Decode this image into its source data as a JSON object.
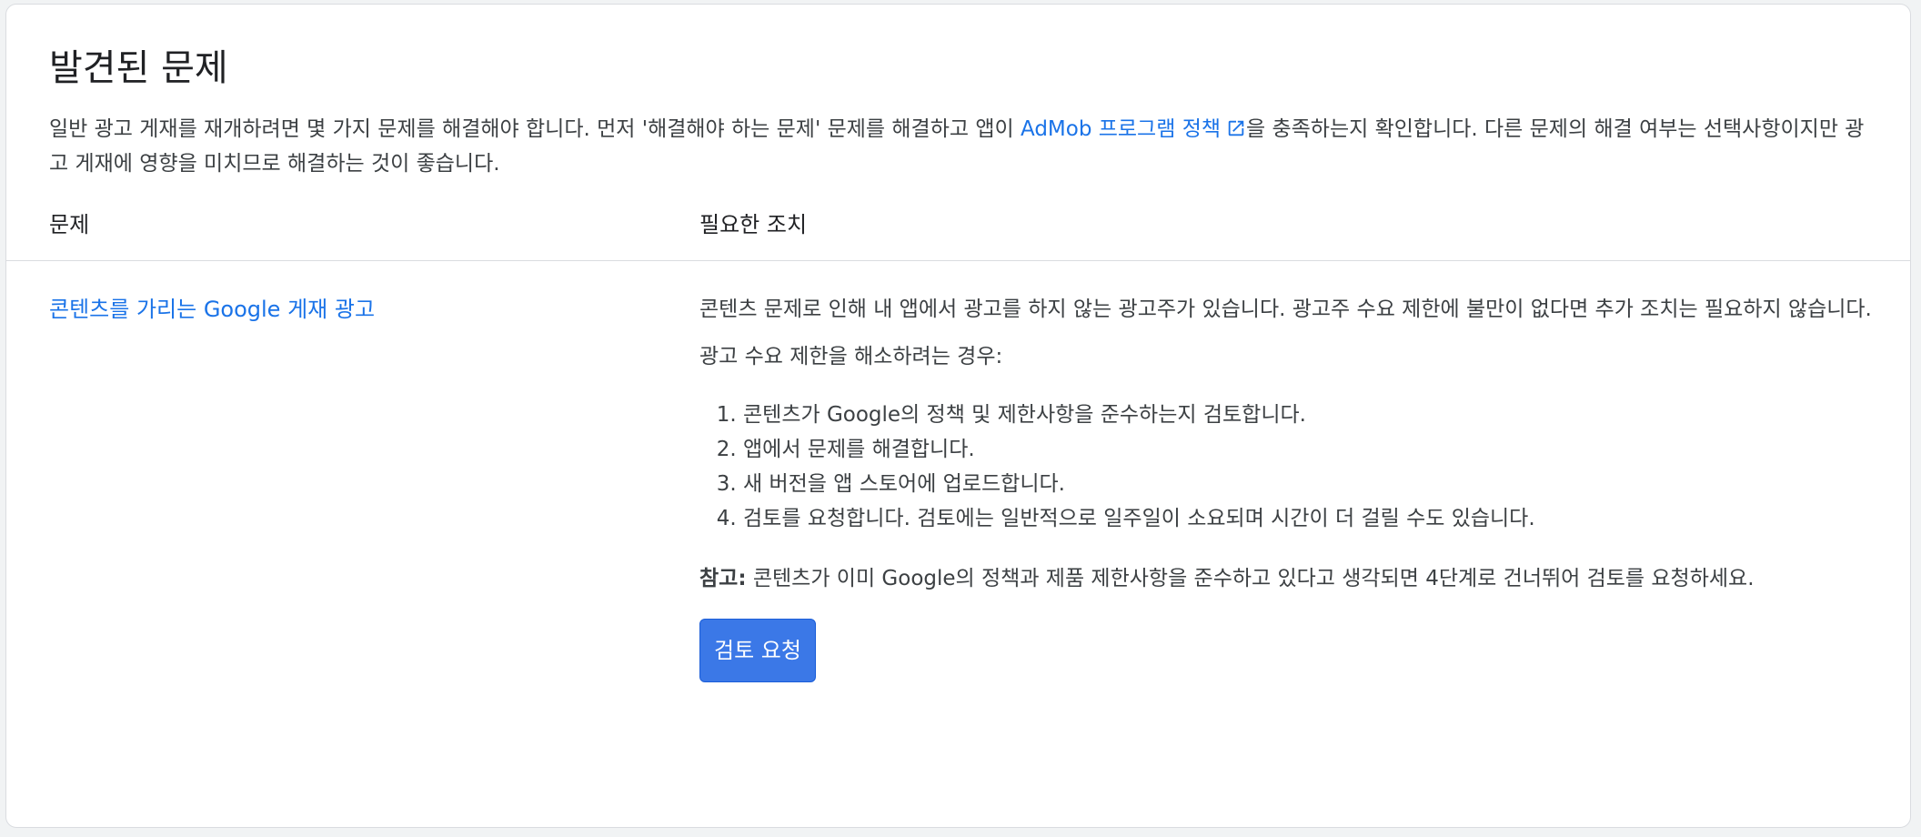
{
  "colors": {
    "link": "#1a73e8",
    "button_bg": "#3b78e7",
    "text": "#3c4043",
    "divider": "#dadce0"
  },
  "header": {
    "title": "발견된 문제"
  },
  "intro": {
    "text_before_link": "일반 광고 게재를 재개하려면 몇 가지 문제를 해결해야 합니다. 먼저 '해결해야 하는 문제' 문제를 해결하고 앱이 ",
    "link_label": "AdMob 프로그램 정책",
    "link_icon": "open-in-new-icon",
    "text_after_link": "을 충족하는지 확인합니다. 다른 문제의 해결 여부는 선택사항이지만 광고 게재에 영향을 미치므로 해결하는 것이 좋습니다."
  },
  "table": {
    "columns": [
      "문제",
      "필요한 조치"
    ],
    "rows": [
      {
        "issue": "콘텐츠를 가리는 Google 게재 광고",
        "action": {
          "summary": "콘텐츠 문제로 인해 내 앱에서 광고를 하지 않는 광고주가 있습니다. 광고주 수요 제한에 불만이 없다면 추가 조치는 필요하지 않습니다.",
          "subheading": "광고 수요 제한을 해소하려는 경우:",
          "steps": [
            "콘텐츠가 Google의 정책 및 제한사항을 준수하는지 검토합니다.",
            "앱에서 문제를 해결합니다.",
            "새 버전을 앱 스토어에 업로드합니다.",
            "검토를 요청합니다. 검토에는 일반적으로 일주일이 소요되며 시간이 더 걸릴 수도 있습니다."
          ],
          "note_label": "참고:",
          "note_text": " 콘텐츠가 이미 Google의 정책과 제품 제한사항을 준수하고 있다고 생각되면 4단계로 건너뛰어 검토를 요청하세요.",
          "button_label": "검토 요청"
        }
      }
    ]
  }
}
